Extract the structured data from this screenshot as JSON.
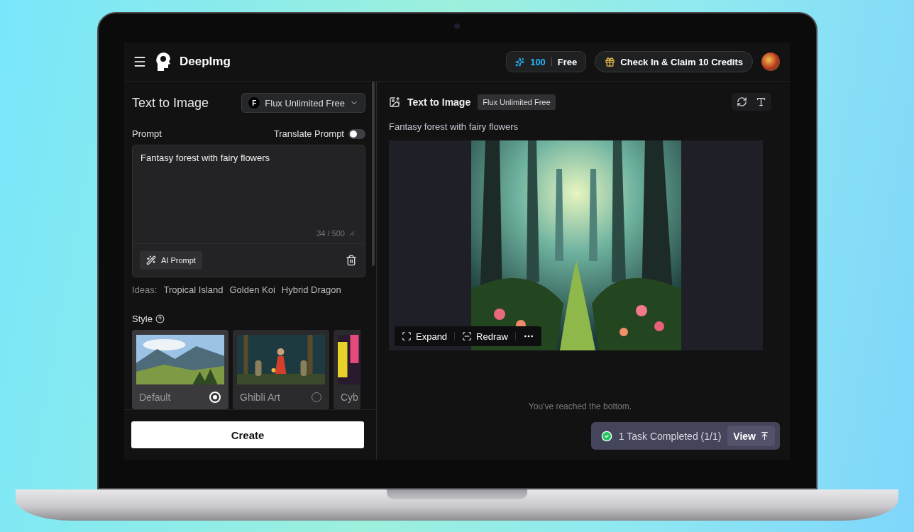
{
  "header": {
    "brand": "DeepImg",
    "credits": {
      "count": "100",
      "plan": "Free"
    },
    "check_in": "Check In & Claim 10 Credits"
  },
  "left": {
    "title": "Text to Image",
    "model": "Flux Unlimited Free",
    "model_badge": "F",
    "prompt_label": "Prompt",
    "translate": {
      "label": "Translate Prompt",
      "on": false
    },
    "prompt": {
      "value": "Fantasy forest with fairy flowers",
      "counter": "34 / 500"
    },
    "ai_prompt": "AI Prompt",
    "ideas_label": "Ideas:",
    "ideas": [
      "Tropical Island",
      "Golden Koi",
      "Hybrid Dragon"
    ],
    "style_label": "Style",
    "styles": [
      {
        "name": "Default",
        "selected": true
      },
      {
        "name": "Ghibli Art",
        "selected": false
      },
      {
        "name": "Cyb"
      }
    ],
    "create": "Create"
  },
  "right": {
    "title": "Text to Image",
    "model_tag": "Flux Unlimited Free",
    "prompt": "Fantasy forest with fairy flowers",
    "result_actions": [
      {
        "label": "Expand",
        "kind": "expand"
      },
      {
        "label": "Redraw",
        "kind": "redraw"
      },
      {
        "kind": "more"
      }
    ],
    "end_note": "You've reached the bottom.",
    "task": {
      "label": "1 Task Completed (1/1)",
      "action": "View"
    }
  }
}
